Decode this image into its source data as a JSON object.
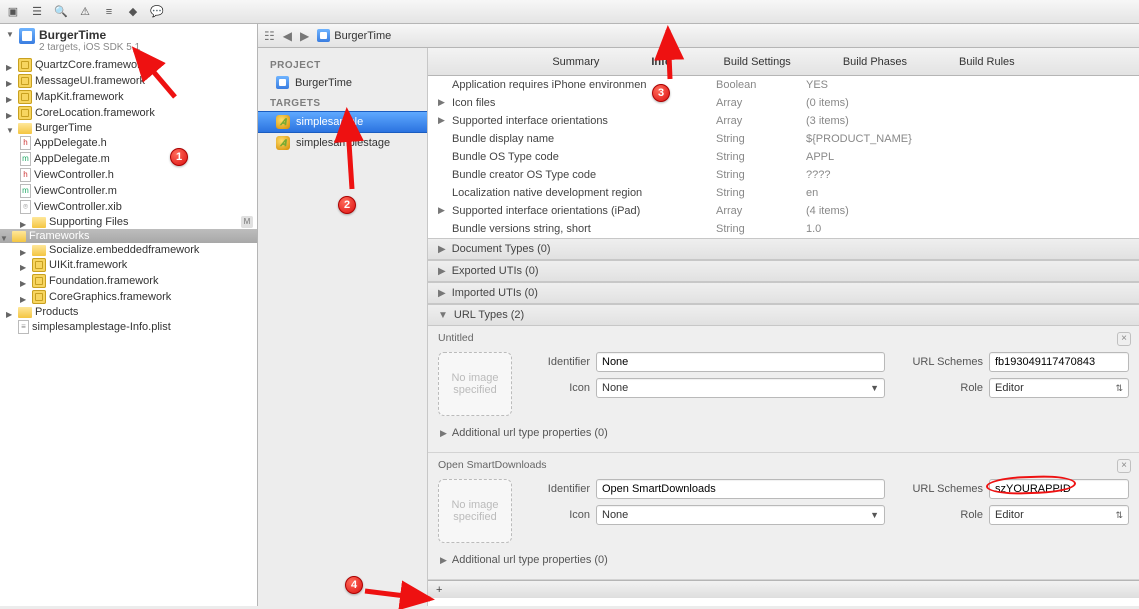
{
  "toolbar_icons": [
    "run-icon",
    "layers-icon",
    "search-icon",
    "warning-icon",
    "tag-icon",
    "breakpoint-icon",
    "log-icon",
    "outline-icon"
  ],
  "jump_icons": [
    "related-icon",
    "back-icon",
    "forward-icon"
  ],
  "breadcrumb": "BurgerTime",
  "navigator": {
    "project_title": "BurgerTime",
    "project_subtitle": "2 targets, iOS SDK 5.1",
    "items": [
      {
        "label": "QuartzCore.framework",
        "icon": "fw",
        "disc": "closed"
      },
      {
        "label": "MessageUI.framework",
        "icon": "fw",
        "disc": "closed"
      },
      {
        "label": "MapKit.framework",
        "icon": "fw",
        "disc": "closed"
      },
      {
        "label": "CoreLocation.framework",
        "icon": "fw",
        "disc": "closed"
      }
    ],
    "group": {
      "label": "BurgerTime",
      "children": [
        {
          "label": "AppDelegate.h",
          "icon": "h"
        },
        {
          "label": "AppDelegate.m",
          "icon": "m"
        },
        {
          "label": "ViewController.h",
          "icon": "h"
        },
        {
          "label": "ViewController.m",
          "icon": "m"
        },
        {
          "label": "ViewController.xib",
          "icon": "xib"
        },
        {
          "label": "Supporting Files",
          "icon": "folder",
          "disc": "closed",
          "badge": "M"
        }
      ]
    },
    "frameworks": {
      "label": "Frameworks",
      "children": [
        {
          "label": "Socialize.embeddedframework",
          "icon": "folder",
          "disc": "closed"
        },
        {
          "label": "UIKit.framework",
          "icon": "fw",
          "disc": "closed"
        },
        {
          "label": "Foundation.framework",
          "icon": "fw",
          "disc": "closed"
        },
        {
          "label": "CoreGraphics.framework",
          "icon": "fw",
          "disc": "closed"
        }
      ]
    },
    "products": {
      "label": "Products",
      "disc": "closed"
    },
    "loose_file": {
      "label": "simplesamplestage-Info.plist",
      "icon": "plist"
    }
  },
  "targets_col": {
    "project_hdr": "PROJECT",
    "project_item": "BurgerTime",
    "targets_hdr": "TARGETS",
    "targets": [
      "simplesample",
      "simplesamplestage"
    ]
  },
  "tabs": [
    "Summary",
    "Info",
    "Build Settings",
    "Build Phases",
    "Build Rules"
  ],
  "tab_selected": "Info",
  "plist": [
    {
      "key": "Application requires iPhone environmen",
      "type": "Boolean",
      "value": "YES"
    },
    {
      "key": "Icon files",
      "type": "Array",
      "value": "(0 items)",
      "disc": "closed"
    },
    {
      "key": "Supported interface orientations",
      "type": "Array",
      "value": "(3 items)",
      "disc": "closed"
    },
    {
      "key": "Bundle display name",
      "type": "String",
      "value": "${PRODUCT_NAME}"
    },
    {
      "key": "Bundle OS Type code",
      "type": "String",
      "value": "APPL"
    },
    {
      "key": "Bundle creator OS Type code",
      "type": "String",
      "value": "????"
    },
    {
      "key": "Localization native development region",
      "type": "String",
      "value": "en"
    },
    {
      "key": "Supported interface orientations (iPad)",
      "type": "Array",
      "value": "(4 items)",
      "disc": "closed"
    },
    {
      "key": "Bundle versions string, short",
      "type": "String",
      "value": "1.0"
    }
  ],
  "sections": {
    "doc_types": "Document Types (0)",
    "exported": "Exported UTIs (0)",
    "imported": "Imported UTIs (0)",
    "url_types": "URL Types (2)"
  },
  "url_blocks": [
    {
      "title": "Untitled",
      "identifier": "None",
      "icon": "None",
      "schemes": "fb193049117470843",
      "role": "Editor",
      "addl": "Additional url type properties (0)"
    },
    {
      "title": "Open SmartDownloads",
      "identifier": "Open SmartDownloads",
      "icon": "None",
      "schemes": "szYOURAPPID",
      "role": "Editor",
      "addl": "Additional url type properties (0)",
      "circled": true
    }
  ],
  "labels": {
    "identifier": "Identifier",
    "icon": "Icon",
    "schemes": "URL Schemes",
    "role": "Role",
    "img_well": "No image specified",
    "add": "+"
  },
  "annotations": {
    "1": "1",
    "2": "2",
    "3": "3",
    "4": "4"
  }
}
